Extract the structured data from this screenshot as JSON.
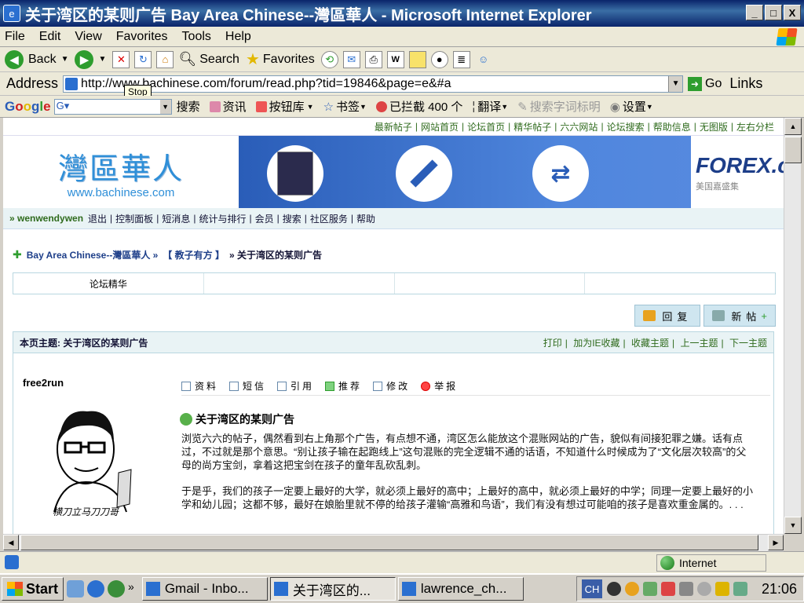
{
  "window": {
    "title": "关于湾区的某则广告 Bay Area Chinese--灣區華人 - Microsoft Internet Explorer",
    "min": "_",
    "max": "□",
    "close": "X"
  },
  "menu": [
    "File",
    "Edit",
    "View",
    "Favorites",
    "Tools",
    "Help"
  ],
  "toolbar": {
    "back": "Back",
    "search": "Search",
    "favorites": "Favorites"
  },
  "address": {
    "label": "Address",
    "url": "http://www.bachinese.com/forum/read.php?tid=19846&page=e&#a",
    "go": "Go",
    "links": "Links",
    "tooltip": "Stop"
  },
  "googlebar": {
    "logo": "Google",
    "search": "搜索",
    "news": "资讯",
    "dict": "按钮库",
    "bookmarks": "书签",
    "blocked": "已拦截 400 个",
    "translate": "翻译",
    "highlight": "搜索字词标明",
    "settings": "设置"
  },
  "page": {
    "topnav": [
      "最新帖子",
      "网站首页",
      "论坛首页",
      "精华帖子",
      "六六网站",
      "论坛搜索",
      "帮助信息",
      "无图版",
      "左右分栏"
    ],
    "logo": {
      "main": "灣區華人",
      "sub": "www.bachinese.com"
    },
    "forex": {
      "main": "FOREX.co",
      "sub": "美国嘉盛集"
    },
    "userbar": {
      "user": "» wenwendywen",
      "items": [
        "退出",
        "控制面板",
        "短消息",
        "统计与排行",
        "会员",
        "搜索",
        "社区服务",
        "帮助"
      ]
    },
    "crumb": [
      "Bay Area Chinese--灣區華人 »",
      "【 教子有方 】",
      "» 关于湾区的某则广告"
    ],
    "digest": "论坛精华",
    "actions": {
      "reply": "回复",
      "new": "新帖"
    },
    "thread": {
      "label": "本页主题: 关于湾区的某则广告",
      "links": [
        "打印",
        "加为IE收藏",
        "收藏主题",
        "上一主题",
        "下一主题"
      ]
    },
    "post": {
      "author": "free2run",
      "avatar_caption": "横刀立马刀刀哥",
      "tools": [
        "资料",
        "短信",
        "引用",
        "推荐",
        "修改",
        "举报"
      ],
      "title": "关于湾区的某则广告",
      "p1": "浏览六六的帖子，偶然看到右上角那个广告，有点想不通，湾区怎么能放这个混账网站的广告，貌似有间接犯罪之嫌。话有点过，不过就是那个意思。“别让孩子输在起跑线上”这句混账的完全逻辑不通的话语，不知道什么时候成为了“文化层次较高”的父母的尚方宝剑，拿着这把宝剑在孩子的童年乱砍乱刺。",
      "p2": "于是乎，我们的孩子一定要上最好的大学，就必须上最好的高中；上最好的高中，就必须上最好的中学；同理一定要上最好的小学和幼儿园；这都不够，最好在娘胎里就不停的给孩子灌输“高雅和鸟语”，我们有没有想过可能咱的孩子是喜欢重金属的。. . ."
    }
  },
  "status": {
    "zone": "Internet"
  },
  "taskbar": {
    "start": "Start",
    "tasks": [
      "Gmail - Inbo...",
      "关于湾区的...",
      "lawrence_ch..."
    ],
    "lang": "CH",
    "clock": "21:06"
  }
}
